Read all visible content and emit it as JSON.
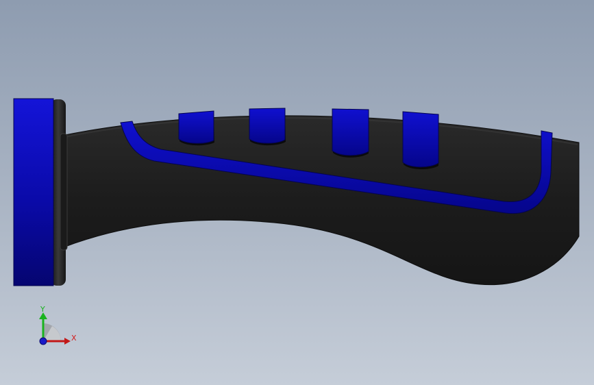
{
  "viewport": {
    "background_top": "#8e9cb0",
    "background_bottom": "#c5cdd8"
  },
  "model": {
    "name": "grip-handle",
    "body_color": "#1f1f1f",
    "accent_color": "#0a0ac8",
    "accent_dark": "#05056e",
    "insert_count": 4
  },
  "triad": {
    "y_label": "Y",
    "x_label": "X",
    "y_color": "#19b31e",
    "x_color": "#d21a1a",
    "z_color": "#1a1ac8"
  }
}
